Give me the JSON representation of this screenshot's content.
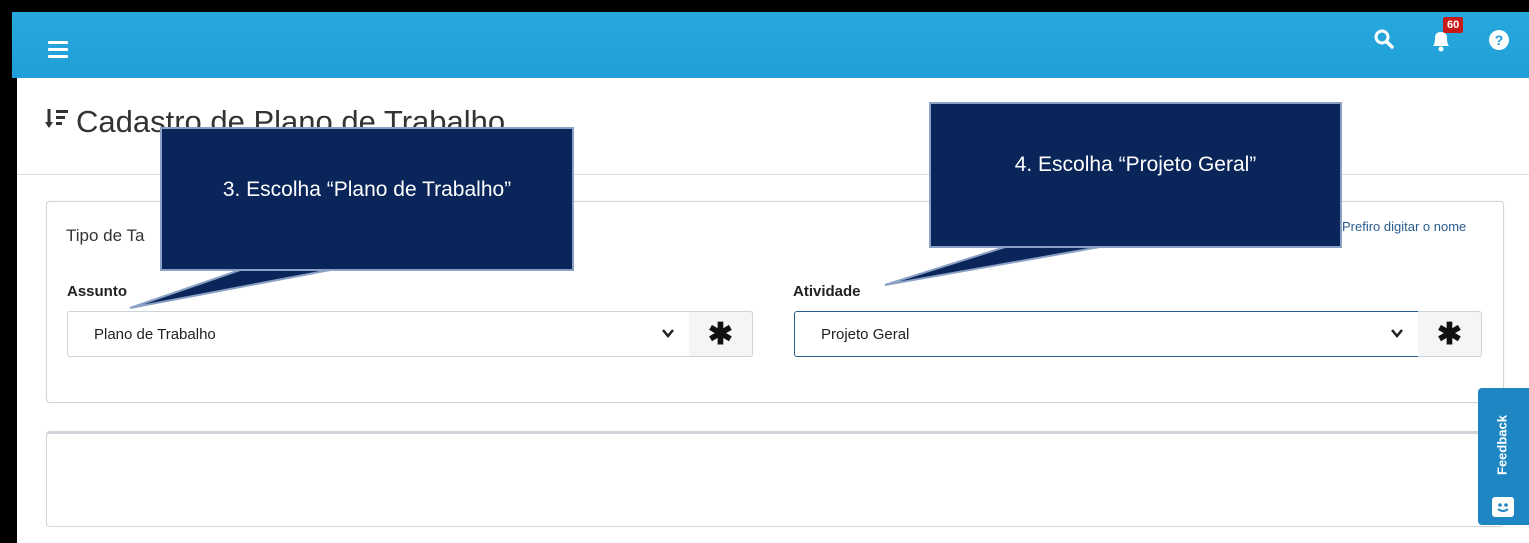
{
  "topbar": {
    "notification_count": "60"
  },
  "page": {
    "title": "Cadastro de Plano de Trabalho"
  },
  "form": {
    "tipo_label": "Tipo de Ta",
    "prefiro_link": "Prefiro digitar o nome",
    "assunto_label": "Assunto",
    "assunto_value": "Plano de Trabalho",
    "atividade_label": "Atividade",
    "atividade_value": "Projeto Geral",
    "required_symbol": "✱"
  },
  "callouts": {
    "step3": "3. Escolha “Plano de Trabalho”",
    "step4": "4. Escolha “Projeto Geral”"
  },
  "feedback": {
    "label": "Feedback"
  },
  "colors": {
    "topbar": "#22a6dc",
    "callout": "#0a2559",
    "badge": "#c91a1a",
    "feedback": "#1f86c4"
  }
}
